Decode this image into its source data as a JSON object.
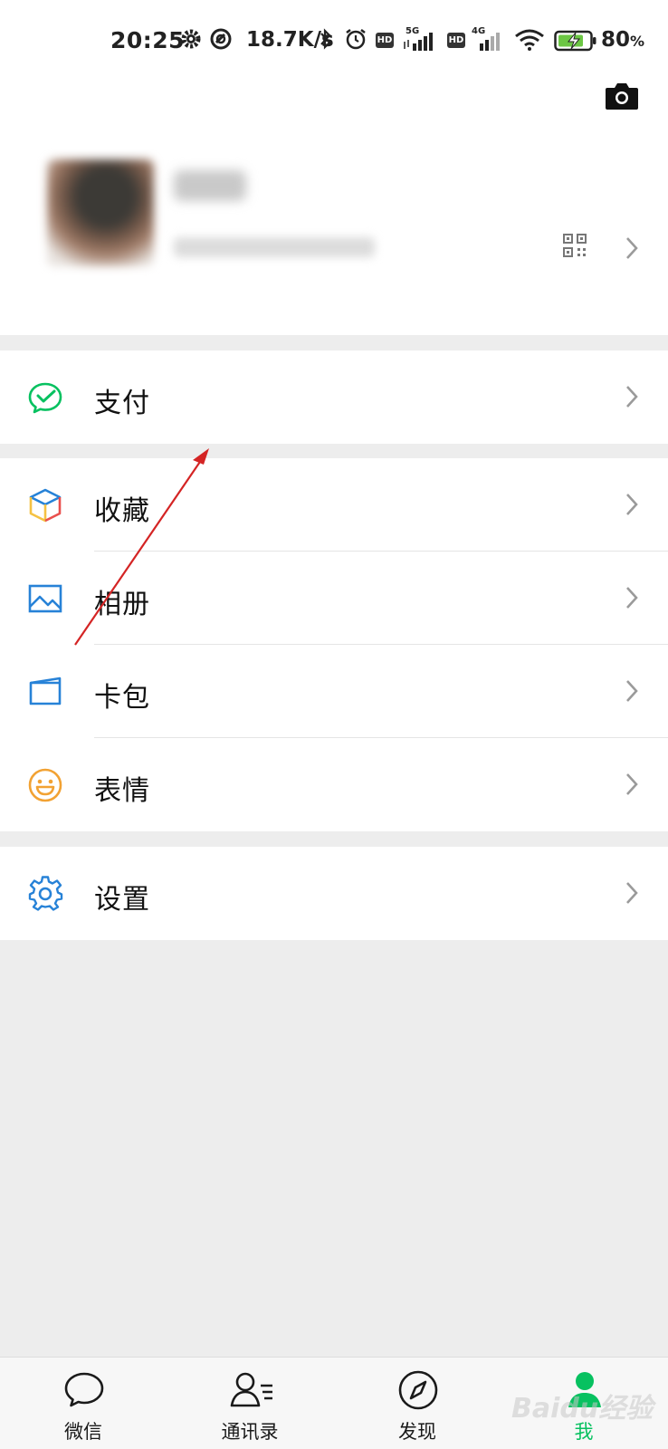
{
  "status_bar": {
    "time": "20:25",
    "net_speed": "18.7K/s",
    "hd_badge": "HD",
    "tag_5g": "5G",
    "tag_4g": "4G",
    "battery_percent": "80",
    "battery_unit": "%",
    "icons": [
      "settings-gear-icon",
      "vpn-icon",
      "bluetooth-icon",
      "alarm-icon",
      "hd-icon",
      "signal-5g-icon",
      "hd-icon",
      "signal-4g-icon",
      "wifi-icon",
      "battery-charging-icon"
    ]
  },
  "profile": {
    "camera_icon": "camera-icon",
    "qr_icon": "qr-code-icon",
    "nickname": "",
    "wechat_id": ""
  },
  "menu": {
    "pay": {
      "label": "支付",
      "icon": "wechat-pay-icon",
      "color": "#07c160"
    },
    "favorites": {
      "label": "收藏",
      "icon": "favorites-cube-icon"
    },
    "album": {
      "label": "相册",
      "icon": "photo-album-icon",
      "color": "#2782d7"
    },
    "card_wallet": {
      "label": "卡包",
      "icon": "card-wallet-icon",
      "color": "#2782d7"
    },
    "stickers": {
      "label": "表情",
      "icon": "sticker-smile-icon",
      "color": "#f2a233"
    },
    "settings": {
      "label": "设置",
      "icon": "settings-gear-icon",
      "color": "#2782d7"
    }
  },
  "tabbar": {
    "tabs": [
      {
        "label": "微信",
        "icon": "chat-bubble-icon",
        "active": false
      },
      {
        "label": "通讯录",
        "icon": "contacts-icon",
        "active": false
      },
      {
        "label": "发现",
        "icon": "compass-icon",
        "active": false
      },
      {
        "label": "我",
        "icon": "me-person-icon",
        "active": true
      }
    ],
    "active_color": "#07c160"
  },
  "watermark": "Baidu经验"
}
